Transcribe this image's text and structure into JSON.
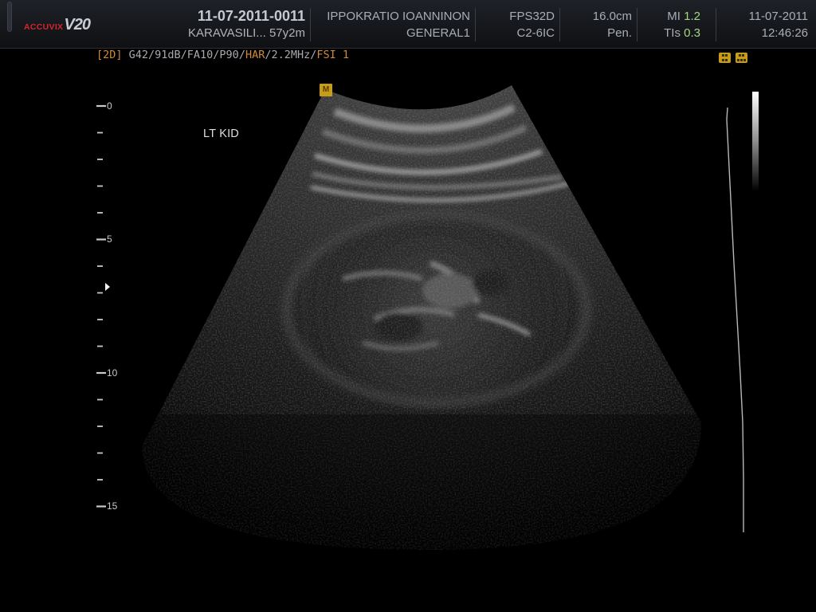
{
  "header": {
    "logo_brand": "ACCUVIX",
    "logo_model": "V20",
    "exam_id": "11-07-2011-0011",
    "patient": "KARAVASILI... 57y2m",
    "institution": "IPPOKRATIO IOANNINON",
    "preset": "GENERAL1",
    "frame_rate": "FPS32D",
    "probe": "C2-6IC",
    "depth": "16.0cm",
    "penetration": "Pen.",
    "mi_label": "MI",
    "mi_value": "1.2",
    "tis_label": "TIs",
    "tis_value": "0.3",
    "date": "11-07-2011",
    "time": "12:46:26"
  },
  "params": {
    "mode": "[2D]",
    "settings_1": " G42/91dB/FA10/P90/",
    "harmonic": "HAR",
    "settings_2": "/2.2MHz/",
    "fsi": "FSI 1"
  },
  "annotation": {
    "label": "LT KID",
    "marker": "M"
  },
  "depth_scale": {
    "labels": [
      "0",
      "5",
      "10",
      "15"
    ],
    "max_cm": 16,
    "focus_cm": 7
  },
  "colors": {
    "accent_orange": "#d18a34",
    "value_green": "#a5d682",
    "brand_red": "#d4252d",
    "icon_yellow": "#c79d18"
  },
  "icons": {
    "status_icon_1": "mi-status-icon",
    "status_icon_2": "son-status-icon"
  }
}
